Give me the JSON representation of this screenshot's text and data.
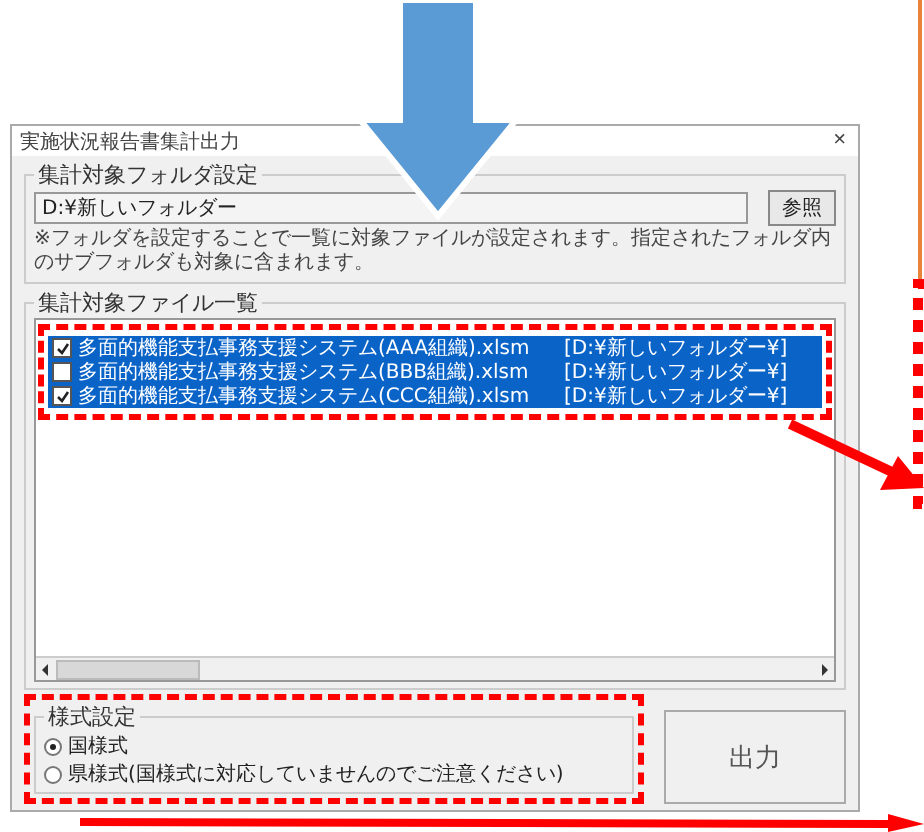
{
  "window": {
    "title": "実施状況報告書集計出力",
    "close": "×"
  },
  "folder_settings": {
    "label": "集計対象フォルダ設定",
    "path": "D:¥新しいフォルダー",
    "browse_button": "参照",
    "note": "※フォルダを設定することで一覧に対象ファイルが設定されます。指定されたフォルダ内のサブフォルダも対象に含まれます。"
  },
  "file_list": {
    "label": "集計対象ファイル一覧",
    "rows": [
      {
        "file": "多面的機能支払事務支援システム(AAA組織).xlsm",
        "folder": "[D:¥新しいフォルダー¥]",
        "checked": true,
        "selected": true
      },
      {
        "file": "多面的機能支払事務支援システム(BBB組織).xlsm",
        "folder": "[D:¥新しいフォルダー¥]",
        "checked": false,
        "selected": true
      },
      {
        "file": "多面的機能支払事務支援システム(CCC組織).xlsm",
        "folder": "[D:¥新しいフォルダー¥]",
        "checked": true,
        "selected": true
      }
    ]
  },
  "format_settings": {
    "label": "様式設定",
    "options": [
      {
        "label": "国様式",
        "selected": true
      },
      {
        "label": "県様式(国様式に対応していませんのでご注意ください)",
        "selected": false
      }
    ]
  },
  "output_button": "出力"
}
